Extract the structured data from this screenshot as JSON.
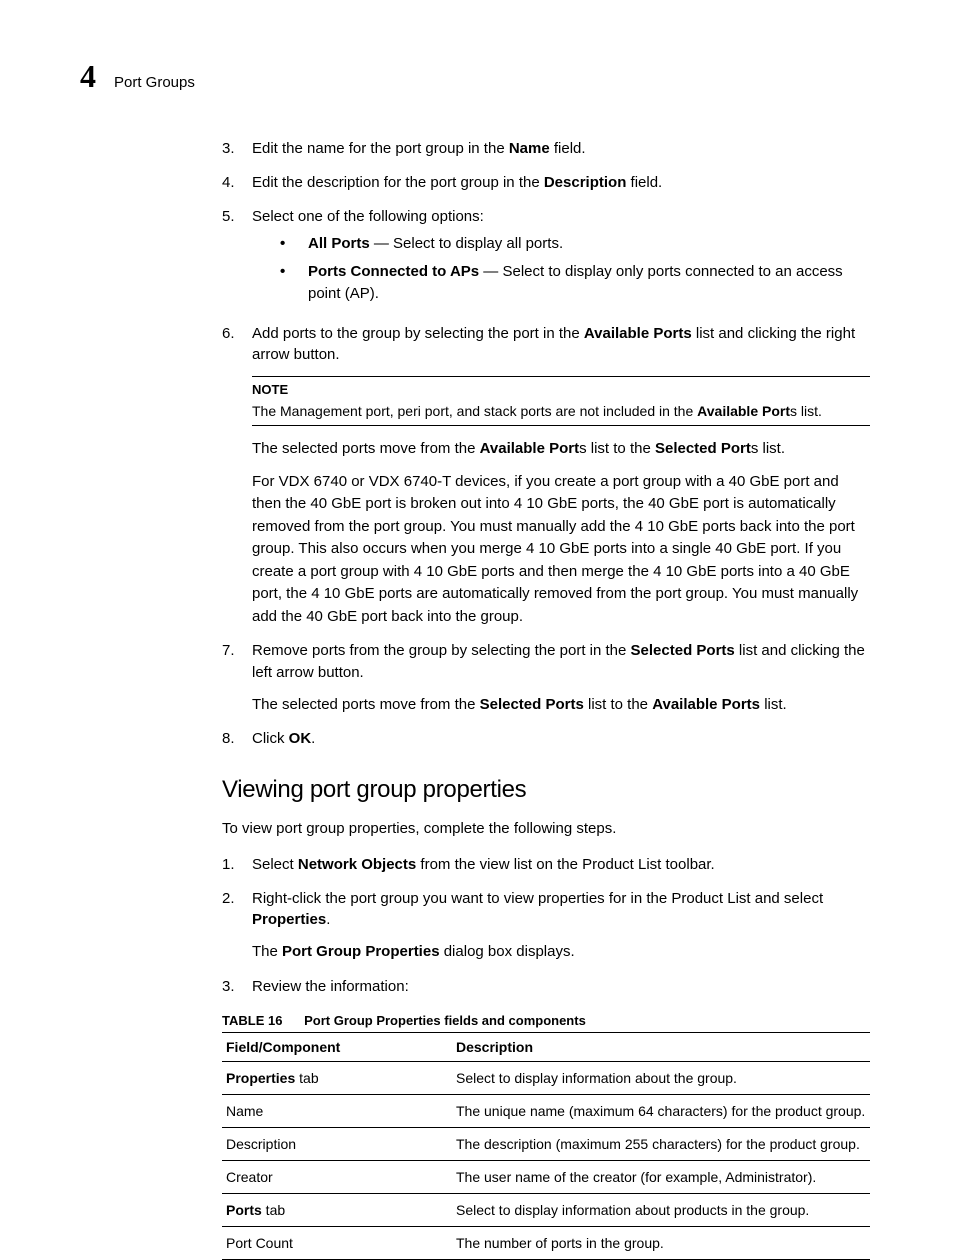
{
  "header": {
    "chapter_number": "4",
    "chapter_title": "Port Groups"
  },
  "steps_a": [
    {
      "num": "3.",
      "parts": [
        "Edit the name for the port group in the ",
        "Name",
        " field."
      ]
    },
    {
      "num": "4.",
      "parts": [
        "Edit the description for the port group in the ",
        "Description",
        " field."
      ]
    },
    {
      "num": "5.",
      "text": "Select one of the following options:",
      "bullets": [
        {
          "bold": "All Ports",
          "rest": " — Select to display all ports."
        },
        {
          "bold": "Ports Connected to APs",
          "rest": " — Select to display only ports connected to an access point (AP)."
        }
      ]
    },
    {
      "num": "6.",
      "parts": [
        "Add ports to the group by selecting the port in the ",
        "Available Ports",
        " list and clicking the right arrow button."
      ],
      "note": {
        "label": "NOTE",
        "pre": "The Management port, peri port, and stack ports are not included in the ",
        "bold": "Available Port",
        "post": "s list."
      },
      "para1": {
        "pre": "The selected ports move from the ",
        "b1": "Available Port",
        "mid": "s list to the ",
        "b2": "Selected Port",
        "post": "s list."
      },
      "para2": "For VDX 6740 or VDX 6740-T devices, if you create a port group with a 40 GbE port and then the 40 GbE port is broken out into 4 10 GbE ports, the 40 GbE port is automatically removed from the port group. You must manually add the 4 10 GbE ports back into the port group. This also occurs when you merge 4 10 GbE ports into a single 40 GbE port. If you create a port group with 4 10 GbE ports and then merge the 4 10 GbE ports into a 40 GbE port, the 4 10 GbE ports are automatically removed from the port group. You must manually add the 40 GbE port back into the group."
    },
    {
      "num": "7.",
      "parts": [
        "Remove ports from the group by selecting the port in the ",
        "Selected Ports",
        " list and clicking the left arrow button."
      ],
      "para1": {
        "pre": "The selected ports move from the ",
        "b1": "Selected Ports",
        "mid": " list to the ",
        "b2": "Available Ports",
        "post": " list."
      }
    },
    {
      "num": "8.",
      "parts": [
        "Click ",
        "OK",
        "."
      ]
    }
  ],
  "section_title": "Viewing port group properties",
  "section_lead": "To view port group properties, complete the following steps.",
  "steps_b": [
    {
      "num": "1.",
      "parts": [
        "Select ",
        "Network Objects",
        " from the view list on the Product List toolbar."
      ]
    },
    {
      "num": "2.",
      "pre": "Right-click the port group you want to view properties for in the Product List and select ",
      "bold": "Properties",
      "post": ".",
      "para1": {
        "pre": "The ",
        "b1": "Port Group Properties",
        "post": " dialog box displays."
      }
    },
    {
      "num": "3.",
      "text": "Review the information:"
    }
  ],
  "table": {
    "label": "TABLE 16",
    "caption": "Port Group Properties fields and components",
    "head": {
      "c1": "Field/Component",
      "c2": "Description"
    },
    "rows": [
      {
        "c1_bold": "Properties",
        "c1_suffix": " tab",
        "c2": "Select to display information about the group.",
        "indent": false
      },
      {
        "c1": "Name",
        "c2": "The unique name (maximum 64 characters) for the product group.",
        "indent": true
      },
      {
        "c1": "Description",
        "c2": "The description (maximum 255 characters) for the product group.",
        "indent": true
      },
      {
        "c1": "Creator",
        "c2": "The user name of the creator (for example, Administrator).",
        "indent": true
      },
      {
        "c1_bold": "Ports",
        "c1_suffix": " tab",
        "c2": "Select to display information about products in the group.",
        "indent": false
      },
      {
        "c1": "Port Count",
        "c2": "The number of ports in the group.",
        "indent": true,
        "last": true
      }
    ]
  }
}
